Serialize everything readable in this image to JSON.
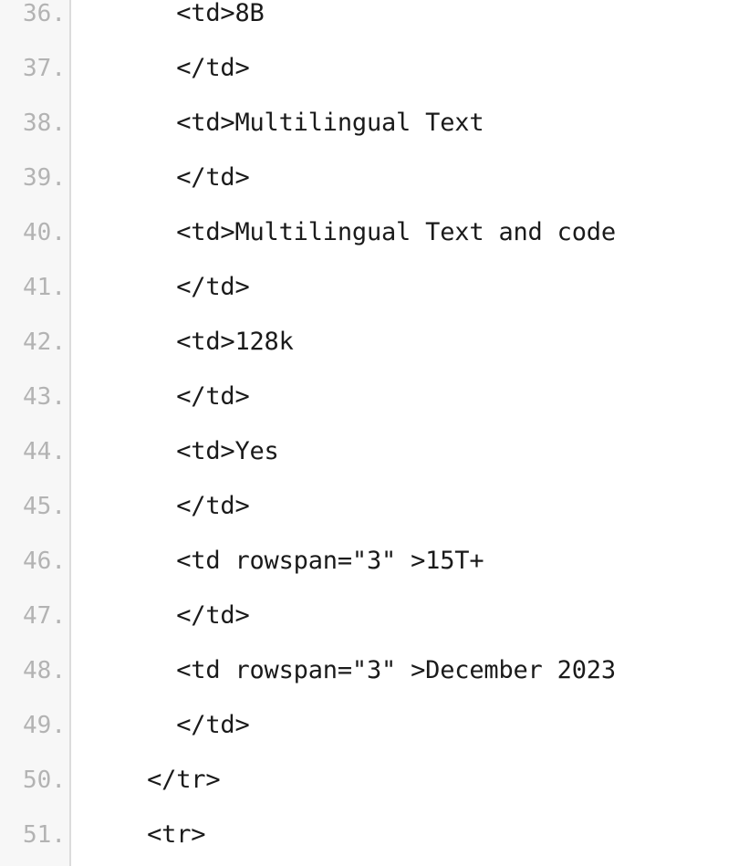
{
  "editor": {
    "title": "code-viewer",
    "language": "html",
    "colors": {
      "background": "#ffffff",
      "gutter_background": "#f7f7f7",
      "gutter_divider": "#dcdcdc",
      "line_number_text": "#b3b3b3",
      "code_text": "#1a1a1a"
    },
    "gutter": {
      "number_suffix": ".",
      "first_visible_line": 36,
      "last_visible_line": 51
    },
    "lines": [
      {
        "number": "36.",
        "code": "    <td>8B"
      },
      {
        "number": "37.",
        "code": "    </td>"
      },
      {
        "number": "38.",
        "code": "    <td>Multilingual Text"
      },
      {
        "number": "39.",
        "code": "    </td>"
      },
      {
        "number": "40.",
        "code": "    <td>Multilingual Text and code"
      },
      {
        "number": "41.",
        "code": "    </td>"
      },
      {
        "number": "42.",
        "code": "    <td>128k"
      },
      {
        "number": "43.",
        "code": "    </td>"
      },
      {
        "number": "44.",
        "code": "    <td>Yes"
      },
      {
        "number": "45.",
        "code": "    </td>"
      },
      {
        "number": "46.",
        "code": "    <td rowspan=\"3\" >15T+"
      },
      {
        "number": "47.",
        "code": "    </td>"
      },
      {
        "number": "48.",
        "code": "    <td rowspan=\"3\" >December 2023"
      },
      {
        "number": "49.",
        "code": "    </td>"
      },
      {
        "number": "50.",
        "code": "  </tr>"
      },
      {
        "number": "51.",
        "code": "  <tr>"
      }
    ]
  }
}
